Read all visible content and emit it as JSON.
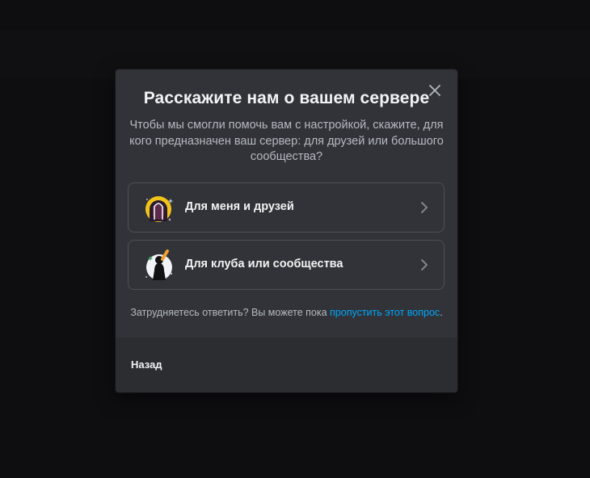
{
  "modal": {
    "title": "Расскажите нам о вашем сервере",
    "subtitle": "Чтобы мы смогли помочь вам с настройкой, скажите, для кого предназначен ваш сервер: для друзей или большого сообщества?",
    "close_icon": "close-icon",
    "options": [
      {
        "label": "Для меня и друзей",
        "icon": "friends-illustration-icon"
      },
      {
        "label": "Для клуба или сообщества",
        "icon": "community-illustration-icon"
      }
    ],
    "hint_text": "Затрудняетесь ответить? Вы можете пока ",
    "hint_link": "пропустить этот вопрос",
    "hint_end": ".",
    "back_label": "Назад"
  },
  "colors": {
    "modal_bg": "#313338",
    "footer_bg": "#2b2d31",
    "link": "#00a8fc",
    "text_primary": "#f2f3f5",
    "text_muted": "#b5bac1",
    "accent_yellow": "#f0c419"
  }
}
